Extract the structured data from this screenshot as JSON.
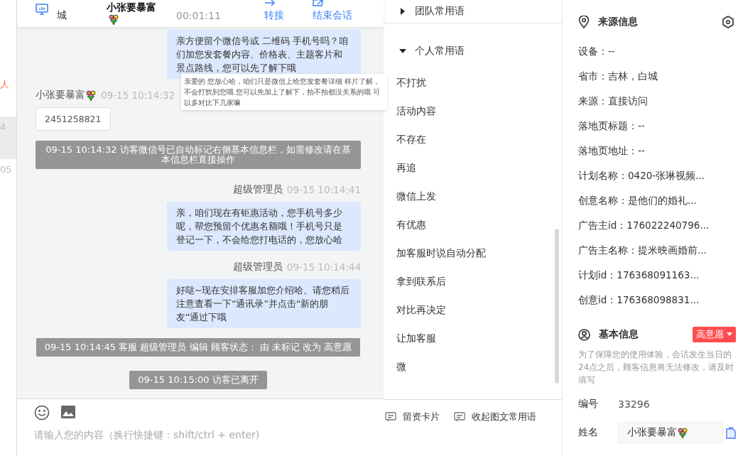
{
  "left_strip": [
    {
      "text": "人",
      "selected": false,
      "color": "#ff6a3d"
    },
    {
      "text": "4",
      "selected": true,
      "color": "#bbbbbb"
    },
    {
      "text": "05",
      "selected": false,
      "color": "#bbbbbb"
    }
  ],
  "header": {
    "location": "城",
    "visitor_name": "小张要暴富",
    "duration": "00:01:11",
    "actions": [
      {
        "label": "转接"
      },
      {
        "label": "结束会话"
      }
    ]
  },
  "messages": [
    {
      "kind": "agent",
      "text": "亲方便留个微信号或 二维码 手机号吗？咱们加您发套餐内容、价格表、主题客片和景点路线，您可以先了解下哦"
    },
    {
      "kind": "visitor",
      "sender": "小张要暴富",
      "time": "09-15 10:14:32",
      "text": "2451258821"
    },
    {
      "kind": "system",
      "text": "09-15 10:14:32 访客微信号已自动标记右侧基本信息栏，如需修改请在基本信息栏直接操作"
    },
    {
      "kind": "agent",
      "sender": "超级管理员",
      "time": "09-15 10:14:41",
      "text": "亲，咱们现在有钜惠活动，您手机号多少呢，帮您预留个优惠名额哦！手机号只是登记一下，不会给您打电话的，您放心哈"
    },
    {
      "kind": "agent",
      "sender": "超级管理员",
      "time": "09-15 10:14:44",
      "text": "好哒~现在安排客服加您介绍哈。请您稍后注意查看一下“通讯录”并点击“新的朋友”通过下哦"
    },
    {
      "kind": "system",
      "text": "09-15 10:14:45 客服 超级管理员 编辑 顾客状态： 由 未标记 改为 高意愿"
    },
    {
      "kind": "system",
      "text": "09-15 10:15:00 访客已离开"
    }
  ],
  "tooltip": {
    "text": "亲爱的 您放心哈，咱们只是微信上给您发套餐详细 样片了解，不会打扰到您哦 您可以先加上了解下，拍不拍都没关系的哦 可以多对比下几家嘛"
  },
  "composer": {
    "placeholder": "请输入您的内容（换行快捷键：shift/ctrl + enter)"
  },
  "quick_phrases": {
    "groups": [
      {
        "title": "团队常用语",
        "expanded": false
      },
      {
        "title": "个人常用语",
        "expanded": true,
        "items": [
          "不打扰",
          "活动内容",
          "不存在",
          "再追",
          "微信上发",
          "有优惠",
          "加客服时说自动分配",
          "拿到联系后",
          "对比再决定",
          "让加客服",
          "微"
        ]
      }
    ],
    "footer_actions": [
      "留资卡片",
      "收起图文常用语"
    ]
  },
  "source_info": {
    "title": "来源信息",
    "fields": [
      "设备：--",
      "省市：吉林，白城",
      "来源：直接访问",
      "落地页标题：--",
      "落地页地址：--",
      "计划名称：0420-张琳视频...",
      "创意名称：是他们的婚礼...",
      "广告主id：176022240796...",
      "广告主名称：提米映画婚前...",
      "计划id：176368091163...",
      "创意id：176368098831..."
    ]
  },
  "basic_info": {
    "title": "基本信息",
    "status": "高意愿",
    "notice": "为了保障您的使用体验，会话发生当日的24点之后，顾客信息将无法修改，请及时填写",
    "fields": [
      {
        "kind": "text",
        "label": "编号",
        "value": "33296"
      },
      {
        "kind": "input",
        "label": "姓名",
        "value": "小张要暴富"
      }
    ]
  }
}
